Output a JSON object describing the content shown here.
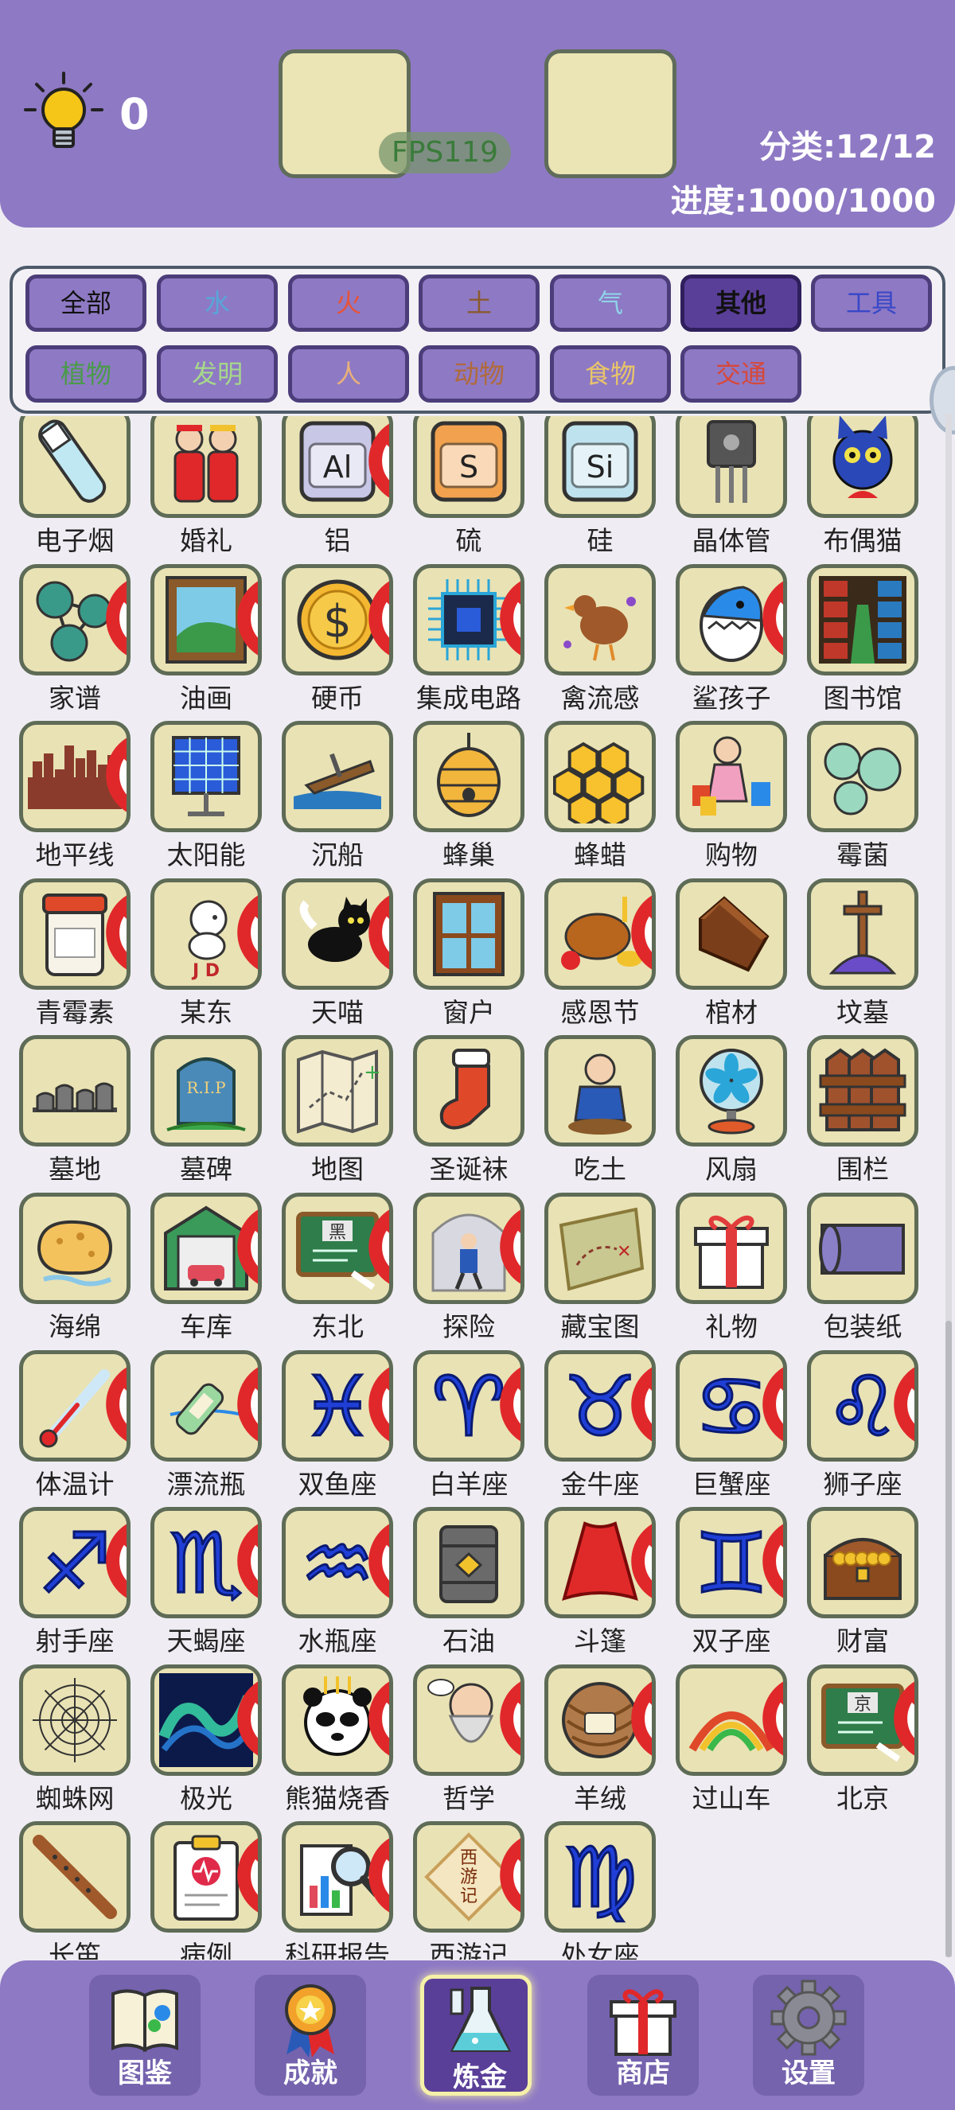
{
  "header": {
    "hint_count": "0",
    "fps": "FPS119",
    "category_progress": "分类:12/12",
    "overall_progress": "进度:1000/1000"
  },
  "categories": [
    {
      "label": "全部",
      "color": "#111111",
      "active": false
    },
    {
      "label": "水",
      "color": "#58a6d8",
      "active": false
    },
    {
      "label": "火",
      "color": "#e6543a",
      "active": false
    },
    {
      "label": "土",
      "color": "#8a5a2e",
      "active": false
    },
    {
      "label": "气",
      "color": "#8fd3e8",
      "active": false
    },
    {
      "label": "其他",
      "color": "#111111",
      "active": true
    },
    {
      "label": "工具",
      "color": "#3848c8",
      "active": false
    },
    {
      "label": "植物",
      "color": "#4a9a4a",
      "active": false
    },
    {
      "label": "发明",
      "color": "#a6d88a",
      "active": false
    },
    {
      "label": "人",
      "color": "#e7b07a",
      "active": false
    },
    {
      "label": "动物",
      "color": "#b06a3a",
      "active": false
    },
    {
      "label": "食物",
      "color": "#e8c46a",
      "active": false
    },
    {
      "label": "交通",
      "color": "#d6483a",
      "active": false
    }
  ],
  "items": [
    {
      "label": "电子烟",
      "icon": "e-cigarette-icon",
      "new": false
    },
    {
      "label": "婚礼",
      "icon": "wedding-couple-icon",
      "new": false
    },
    {
      "label": "铝",
      "icon": "aluminum-element-icon",
      "new": true,
      "text": "Al"
    },
    {
      "label": "硫",
      "icon": "sulfur-element-icon",
      "new": false,
      "text": "S"
    },
    {
      "label": "硅",
      "icon": "silicon-element-icon",
      "new": false,
      "text": "Si"
    },
    {
      "label": "晶体管",
      "icon": "transistor-icon",
      "new": false
    },
    {
      "label": "布偶猫",
      "icon": "blue-cat-icon",
      "new": false
    },
    {
      "label": "家谱",
      "icon": "family-tree-icon",
      "new": true
    },
    {
      "label": "油画",
      "icon": "oil-painting-icon",
      "new": true
    },
    {
      "label": "硬币",
      "icon": "coin-icon",
      "new": true
    },
    {
      "label": "集成电路",
      "icon": "chip-icon",
      "new": true
    },
    {
      "label": "禽流感",
      "icon": "sick-chicken-icon",
      "new": false
    },
    {
      "label": "鲨孩子",
      "icon": "shark-egg-icon",
      "new": true
    },
    {
      "label": "图书馆",
      "icon": "library-icon",
      "new": false
    },
    {
      "label": "地平线",
      "icon": "skyline-icon",
      "new": true
    },
    {
      "label": "太阳能",
      "icon": "solar-panel-icon",
      "new": false
    },
    {
      "label": "沉船",
      "icon": "shipwreck-icon",
      "new": false
    },
    {
      "label": "蜂巢",
      "icon": "beehive-icon",
      "new": false
    },
    {
      "label": "蜂蜡",
      "icon": "honeycomb-icon",
      "new": false
    },
    {
      "label": "购物",
      "icon": "shopping-girl-icon",
      "new": false
    },
    {
      "label": "霉菌",
      "icon": "mold-icon",
      "new": false
    },
    {
      "label": "青霉素",
      "icon": "penicillin-jar-icon",
      "new": true
    },
    {
      "label": "某东",
      "icon": "dog-mascot-icon",
      "new": true,
      "text": "J D"
    },
    {
      "label": "天喵",
      "icon": "black-cat-icon",
      "new": true
    },
    {
      "label": "窗户",
      "icon": "window-icon",
      "new": false
    },
    {
      "label": "感恩节",
      "icon": "roast-turkey-icon",
      "new": true
    },
    {
      "label": "棺材",
      "icon": "coffin-icon",
      "new": false
    },
    {
      "label": "坟墓",
      "icon": "grave-cross-icon",
      "new": false
    },
    {
      "label": "墓地",
      "icon": "graveyard-icon",
      "new": false
    },
    {
      "label": "墓碑",
      "icon": "tombstone-icon",
      "new": false,
      "text": "R.I.P"
    },
    {
      "label": "地图",
      "icon": "map-icon",
      "new": false
    },
    {
      "label": "圣诞袜",
      "icon": "christmas-stocking-icon",
      "new": false
    },
    {
      "label": "吃土",
      "icon": "eating-dirt-icon",
      "new": false
    },
    {
      "label": "风扇",
      "icon": "fan-icon",
      "new": false
    },
    {
      "label": "围栏",
      "icon": "fence-icon",
      "new": false
    },
    {
      "label": "海绵",
      "icon": "sponge-icon",
      "new": false
    },
    {
      "label": "车库",
      "icon": "garage-icon",
      "new": true
    },
    {
      "label": "东北",
      "icon": "chalkboard-icon",
      "new": true,
      "text": "黑"
    },
    {
      "label": "探险",
      "icon": "explorer-icon",
      "new": true
    },
    {
      "label": "藏宝图",
      "icon": "treasure-map-icon",
      "new": false
    },
    {
      "label": "礼物",
      "icon": "gift-icon",
      "new": false
    },
    {
      "label": "包装纸",
      "icon": "wrapping-paper-icon",
      "new": false
    },
    {
      "label": "体温计",
      "icon": "thermometer-icon",
      "new": true
    },
    {
      "label": "漂流瓶",
      "icon": "message-bottle-icon",
      "new": true
    },
    {
      "label": "双鱼座",
      "icon": "pisces-icon",
      "new": true,
      "text": "♓"
    },
    {
      "label": "白羊座",
      "icon": "aries-icon",
      "new": true,
      "text": "♈"
    },
    {
      "label": "金牛座",
      "icon": "taurus-icon",
      "new": true,
      "text": "♉"
    },
    {
      "label": "巨蟹座",
      "icon": "cancer-icon",
      "new": true,
      "text": "♋"
    },
    {
      "label": "狮子座",
      "icon": "leo-icon",
      "new": true,
      "text": "♌"
    },
    {
      "label": "射手座",
      "icon": "sagittarius-icon",
      "new": true,
      "text": "♐"
    },
    {
      "label": "天蝎座",
      "icon": "scorpio-icon",
      "new": true,
      "text": "♏"
    },
    {
      "label": "水瓶座",
      "icon": "aquarius-icon",
      "new": true,
      "text": "♒"
    },
    {
      "label": "石油",
      "icon": "oil-barrel-icon",
      "new": false
    },
    {
      "label": "斗篷",
      "icon": "cape-icon",
      "new": true
    },
    {
      "label": "双子座",
      "icon": "gemini-icon",
      "new": true,
      "text": "♊"
    },
    {
      "label": "财富",
      "icon": "treasure-chest-icon",
      "new": false
    },
    {
      "label": "蜘蛛网",
      "icon": "spider-web-icon",
      "new": false
    },
    {
      "label": "极光",
      "icon": "aurora-icon",
      "new": true
    },
    {
      "label": "熊猫烧香",
      "icon": "panda-incense-icon",
      "new": true
    },
    {
      "label": "哲学",
      "icon": "philosopher-icon",
      "new": true
    },
    {
      "label": "羊绒",
      "icon": "yarn-ball-icon",
      "new": true
    },
    {
      "label": "过山车",
      "icon": "roller-coaster-icon",
      "new": true
    },
    {
      "label": "北京",
      "icon": "chalkboard-beijing-icon",
      "new": true,
      "text": "京"
    },
    {
      "label": "长笛",
      "icon": "flute-icon",
      "new": false
    },
    {
      "label": "病例",
      "icon": "medical-record-icon",
      "new": true
    },
    {
      "label": "科研报告",
      "icon": "research-report-icon",
      "new": true
    },
    {
      "label": "西游记",
      "icon": "journey-west-book-icon",
      "new": true,
      "text": "西游记"
    },
    {
      "label": "处女座",
      "icon": "virgo-icon",
      "new": false,
      "text": "♍"
    }
  ],
  "nav": [
    {
      "label": "图鉴",
      "icon": "book-icon",
      "active": false
    },
    {
      "label": "成就",
      "icon": "medal-icon",
      "active": false
    },
    {
      "label": "炼金",
      "icon": "flask-icon",
      "active": true
    },
    {
      "label": "商店",
      "icon": "gift-shop-icon",
      "active": false
    },
    {
      "label": "设置",
      "icon": "gear-icon",
      "active": false
    }
  ]
}
